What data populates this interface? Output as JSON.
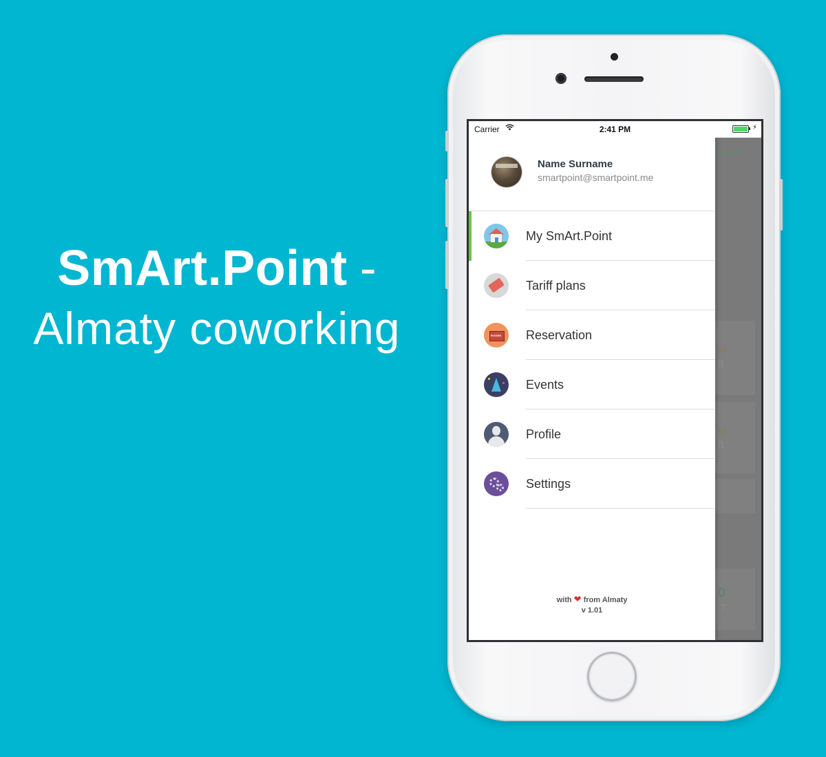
{
  "headline": {
    "brand": "SmArt.Point",
    "dash": "-",
    "subtitle": "Almaty coworking"
  },
  "status_bar": {
    "carrier": "Carrier",
    "time": "2:41 PM"
  },
  "background_content": {
    "amount_top": "67,000 ₸",
    "card1_line1": "ys",
    "card1_line2": "ft",
    "card2_line1": "ys",
    "card2_line2": "ft",
    "bottom_number": "0",
    "bottom_currency": "₸"
  },
  "drawer": {
    "profile": {
      "name": "Name Surname",
      "email": "smartpoint@smartpoint.me"
    },
    "menu": [
      {
        "label": "My SmArt.Point",
        "icon": "house-icon",
        "active": true
      },
      {
        "label": "Tariff plans",
        "icon": "price-tag-icon",
        "active": false
      },
      {
        "label": "Reservation",
        "icon": "rooms-sign-icon",
        "active": false
      },
      {
        "label": "Events",
        "icon": "party-hat-icon",
        "active": false
      },
      {
        "label": "Profile",
        "icon": "user-icon",
        "active": false
      },
      {
        "label": "Settings",
        "icon": "gears-icon",
        "active": false
      }
    ],
    "footer": {
      "with": "with",
      "heart": "❤",
      "from": "from Almaty",
      "version": "v 1.01"
    }
  },
  "colors": {
    "background": "#00b6d1",
    "active_indicator": "#6cc04a",
    "heart": "#e0302d"
  }
}
